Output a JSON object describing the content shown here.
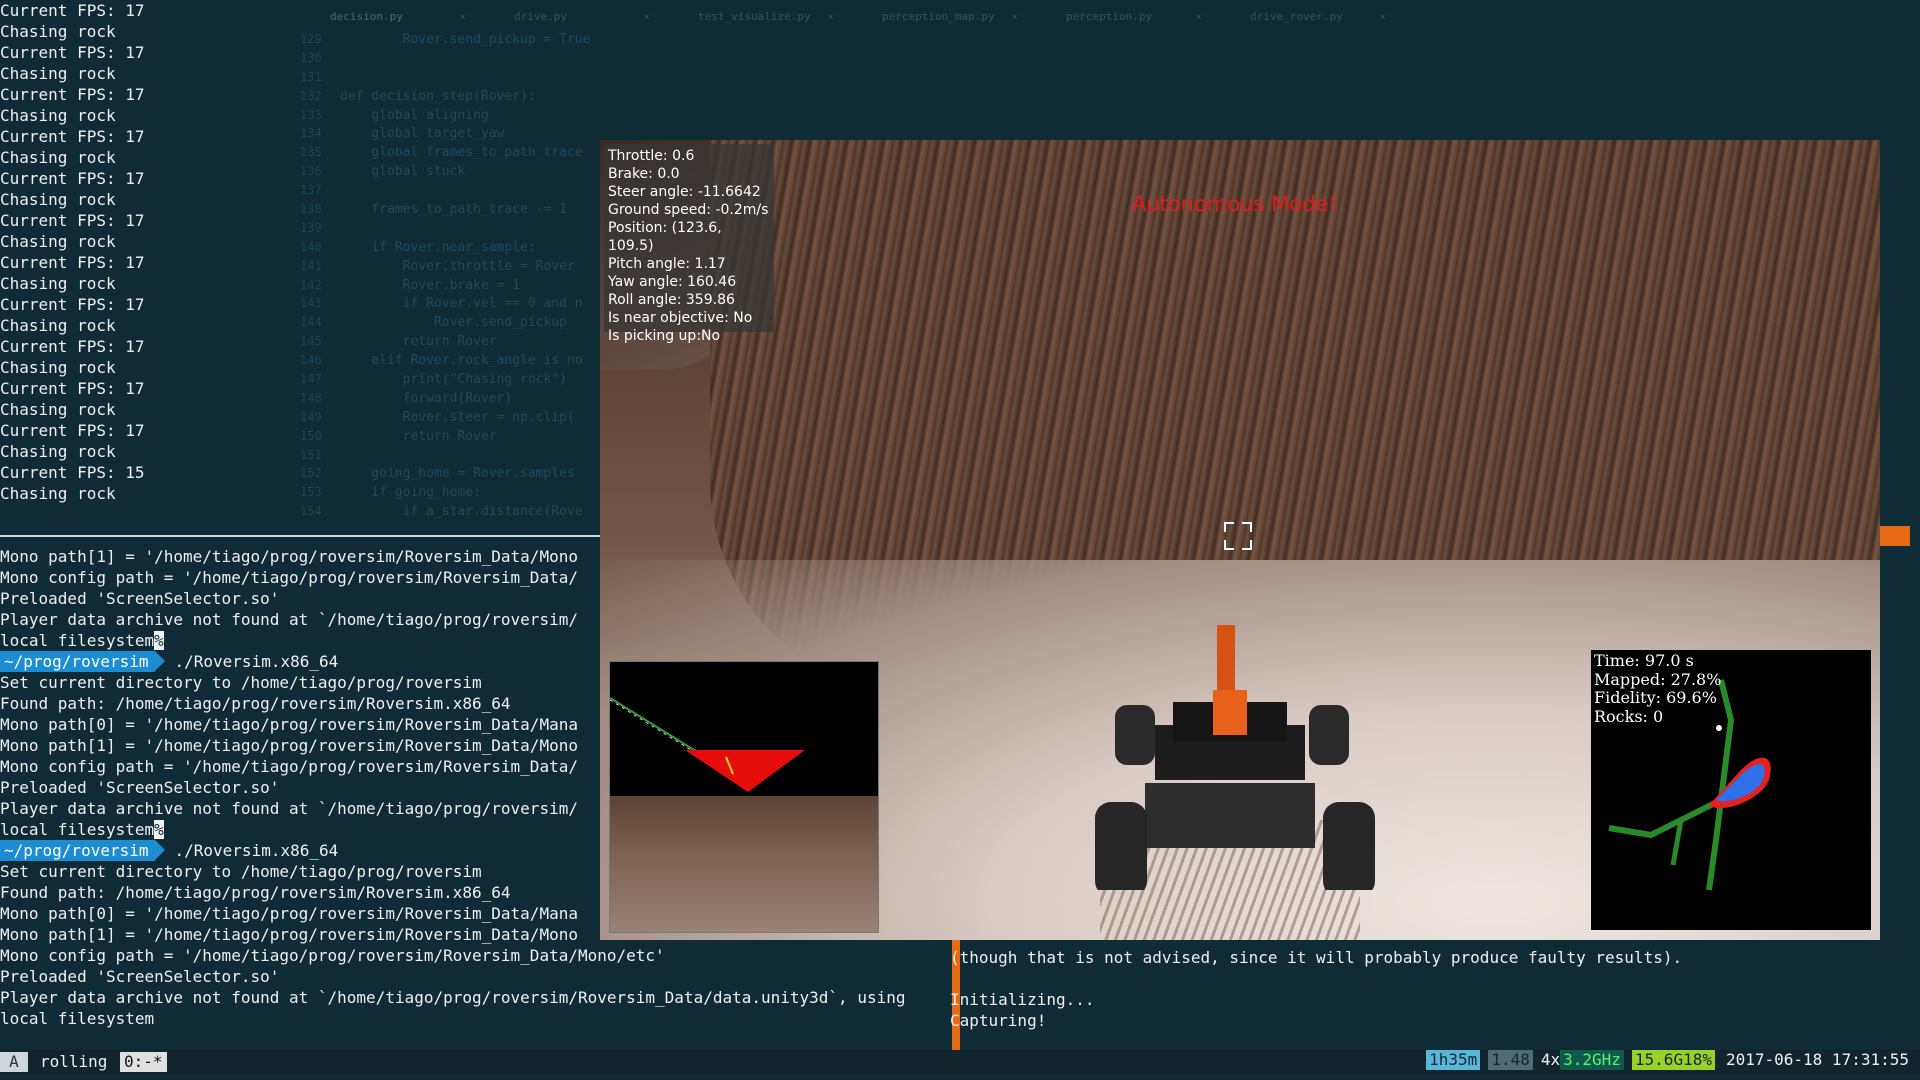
{
  "editor": {
    "tabs": [
      "decision.py",
      "drive.py",
      "test_visualize.py",
      "perception_map.py",
      "perception.py",
      "drive_rover.py"
    ],
    "line_numbers": [
      "129",
      "130",
      "131",
      "132",
      "133",
      "134",
      "135",
      "136",
      "137",
      "138",
      "139",
      "140",
      "141",
      "142",
      "143",
      "144",
      "145",
      "146",
      "147",
      "148",
      "149",
      "150",
      "151",
      "152",
      "153",
      "154"
    ],
    "code_lines": [
      "        Rover.send_pickup = True",
      "",
      "",
      "def decision_step(Rover):",
      "    global aligning",
      "    global target_yaw",
      "    global frames_to_path_trace",
      "    global stuck",
      "",
      "    frames_to_path_trace -= 1",
      "",
      "    if Rover.near_sample:",
      "        Rover.throttle = Rover",
      "        Rover.brake = 1",
      "        if Rover.vel == 0 and n",
      "            Rover.send_pickup",
      "        return Rover",
      "    elif Rover.rock_angle is no",
      "        print(\"Chasing rock\")",
      "        forward(Rover)",
      "        Rover.steer = np.clip(",
      "        return Rover",
      "",
      "    going_home = Rover.samples",
      "    if going_home:",
      "        if a_star.distance(Rove"
    ]
  },
  "terminal_top": {
    "lines": [
      "Current FPS: 17",
      "Chasing rock",
      "Current FPS: 17",
      "Chasing rock",
      "Current FPS: 17",
      "Chasing rock",
      "Current FPS: 17",
      "Chasing rock",
      "Current FPS: 17",
      "Chasing rock",
      "Current FPS: 17",
      "Chasing rock",
      "Current FPS: 17",
      "Chasing rock",
      "Current FPS: 17",
      "Chasing rock",
      "Current FPS: 17",
      "Chasing rock",
      "Current FPS: 17",
      "Chasing rock",
      "Current FPS: 17",
      "Chasing rock",
      "Current FPS: 15",
      "Chasing rock"
    ]
  },
  "terminal_bottom": {
    "line01": "Mono path[1] = '/home/tiago/prog/roversim/Roversim_Data/Mono",
    "line02": "Mono config path = '/home/tiago/prog/roversim/Roversim_Data/",
    "line03": "Preloaded 'ScreenSelector.so'",
    "line04": "Player data archive not found at `/home/tiago/prog/roversim/",
    "line05": "local filesystem",
    "prompt_path": "~/prog/roversim",
    "command": "./Roversim.x86_64",
    "line07": "Set current directory to /home/tiago/prog/roversim",
    "line08": "Found path: /home/tiago/prog/roversim/Roversim.x86_64",
    "line09": "Mono path[0] = '/home/tiago/prog/roversim/Roversim_Data/Mana",
    "line10": "Mono path[1] = '/home/tiago/prog/roversim/Roversim_Data/Mono",
    "line11": "Mono config path = '/home/tiago/prog/roversim/Roversim_Data/",
    "line12": "Preloaded 'ScreenSelector.so'",
    "line13": "Player data archive not found at `/home/tiago/prog/roversim/",
    "line14": "local filesystem",
    "line16": "Set current directory to /home/tiago/prog/roversim",
    "line17": "Found path: /home/tiago/prog/roversim/Roversim.x86_64",
    "line18": "Mono path[0] = '/home/tiago/prog/roversim/Roversim_Data/Mana",
    "line19": "Mono path[1] = '/home/tiago/prog/roversim/Roversim_Data/Mono",
    "line20": "Mono config path = '/home/tiago/prog/roversim/Roversim_Data/Mono/etc'",
    "line21": "Preloaded 'ScreenSelector.so'",
    "line22": "Player data archive not found at `/home/tiago/prog/roversim/Roversim_Data/data.unity3d`, using",
    "line23": "local filesystem",
    "percent_marker": "%"
  },
  "terminal_right": {
    "line1": "(though that is not advised, since it will probably produce faulty results).",
    "line2": "",
    "line3": "Initializing...",
    "line4": "Capturing!"
  },
  "simulator": {
    "telemetry": {
      "throttle": "Throttle: 0.6",
      "brake": "Brake: 0.0",
      "steer": "Steer angle: -11.6642",
      "speed": "Ground speed: -0.2m/s",
      "position": "Position: (123.6, 109.5)",
      "pitch": "Pitch angle: 1.17",
      "yaw": "Yaw angle: 160.46",
      "roll": "Roll angle: 359.86",
      "near": "Is near objective: No",
      "picking": "Is picking up:No"
    },
    "mode_banner": "Autonomous Mode!",
    "minimap": {
      "time": "Time: 97.0 s",
      "mapped": "Mapped: 27.8%",
      "fidelity": "Fidelity: 69.6%",
      "rocks": "Rocks: 0"
    }
  },
  "statusbar": {
    "session_letter": "A",
    "session_name": "rolling",
    "window": "0:-*",
    "uptime": "1h35m",
    "load": "1.48",
    "cpu_count": "4x",
    "cpu_freq": "3.2GHz",
    "memory": "15.6G18%",
    "datetime": "2017-06-18 17:31:55"
  },
  "colors": {
    "background": "#0e2b36",
    "prompt_blue": "#1d8dd3",
    "accent_orange": "#e56a13",
    "banner_red": "#e21b1b"
  }
}
